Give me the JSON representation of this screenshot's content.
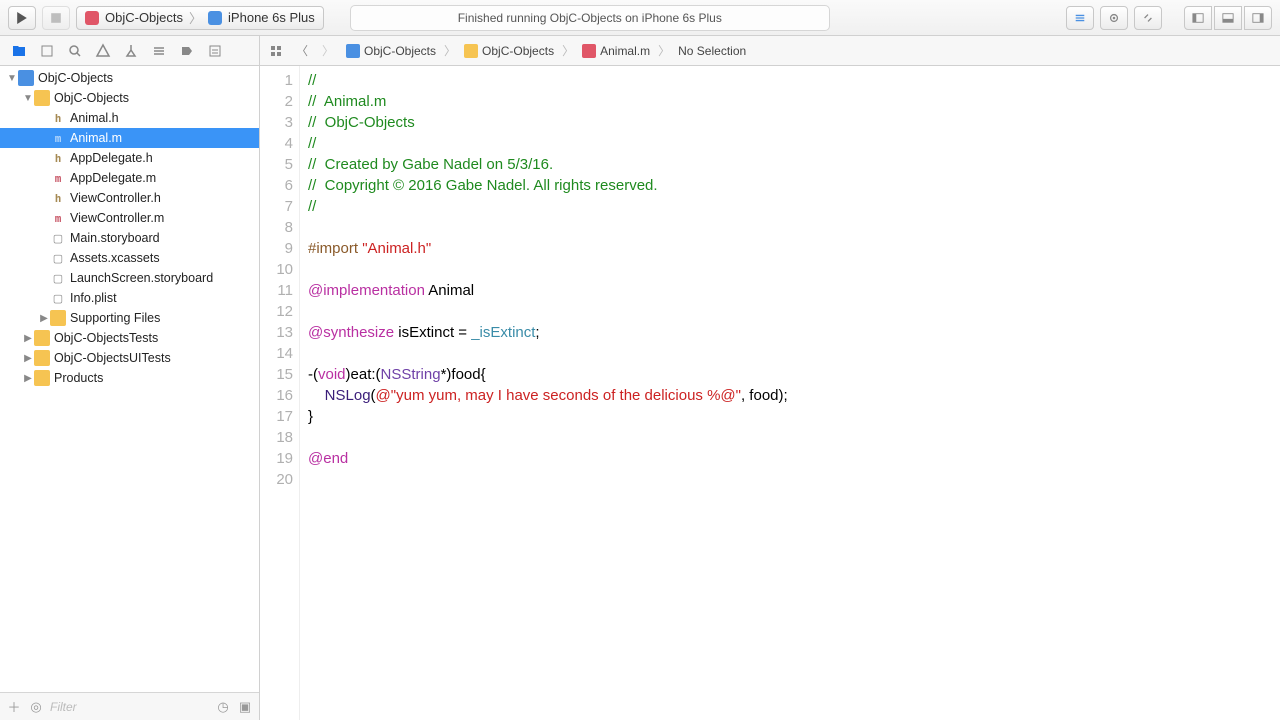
{
  "toolbar": {
    "scheme_target": "ObjC-Objects",
    "scheme_device": "iPhone 6s Plus",
    "status": "Finished running ObjC-Objects on iPhone 6s Plus"
  },
  "jumpbar": {
    "seg1": "ObjC-Objects",
    "seg2": "ObjC-Objects",
    "seg3": "Animal.m",
    "seg4": "No Selection"
  },
  "tree": [
    {
      "depth": 0,
      "kind": "proj",
      "label": "ObjC-Objects",
      "disclosure": "down"
    },
    {
      "depth": 1,
      "kind": "folder",
      "label": "ObjC-Objects",
      "disclosure": "down"
    },
    {
      "depth": 2,
      "kind": "h",
      "label": "Animal.h"
    },
    {
      "depth": 2,
      "kind": "m",
      "label": "Animal.m",
      "selected": true
    },
    {
      "depth": 2,
      "kind": "h",
      "label": "AppDelegate.h"
    },
    {
      "depth": 2,
      "kind": "m",
      "label": "AppDelegate.m"
    },
    {
      "depth": 2,
      "kind": "h",
      "label": "ViewController.h"
    },
    {
      "depth": 2,
      "kind": "m",
      "label": "ViewController.m"
    },
    {
      "depth": 2,
      "kind": "g",
      "label": "Main.storyboard"
    },
    {
      "depth": 2,
      "kind": "g",
      "label": "Assets.xcassets"
    },
    {
      "depth": 2,
      "kind": "g",
      "label": "LaunchScreen.storyboard"
    },
    {
      "depth": 2,
      "kind": "g",
      "label": "Info.plist"
    },
    {
      "depth": 2,
      "kind": "folder",
      "label": "Supporting Files",
      "disclosure": "right"
    },
    {
      "depth": 1,
      "kind": "folder",
      "label": "ObjC-ObjectsTests",
      "disclosure": "right"
    },
    {
      "depth": 1,
      "kind": "folder",
      "label": "ObjC-ObjectsUITests",
      "disclosure": "right"
    },
    {
      "depth": 1,
      "kind": "folder",
      "label": "Products",
      "disclosure": "right"
    }
  ],
  "filter_placeholder": "Filter",
  "code_lines": [
    [
      {
        "c": "c-comment",
        "t": "//"
      }
    ],
    [
      {
        "c": "c-comment",
        "t": "//  Animal.m"
      }
    ],
    [
      {
        "c": "c-comment",
        "t": "//  ObjC-Objects"
      }
    ],
    [
      {
        "c": "c-comment",
        "t": "//"
      }
    ],
    [
      {
        "c": "c-comment",
        "t": "//  Created by Gabe Nadel on 5/3/16."
      }
    ],
    [
      {
        "c": "c-comment",
        "t": "//  Copyright © 2016 Gabe Nadel. All rights reserved."
      }
    ],
    [
      {
        "c": "c-comment",
        "t": "//"
      }
    ],
    [
      {
        "c": "",
        "t": ""
      }
    ],
    [
      {
        "c": "c-pp",
        "t": "#import "
      },
      {
        "c": "c-str",
        "t": "\"Animal.h\""
      }
    ],
    [
      {
        "c": "",
        "t": ""
      }
    ],
    [
      {
        "c": "c-kw",
        "t": "@implementation"
      },
      {
        "c": "",
        "t": " Animal"
      }
    ],
    [
      {
        "c": "",
        "t": ""
      }
    ],
    [
      {
        "c": "c-kw",
        "t": "@synthesize"
      },
      {
        "c": "",
        "t": " isExtinct = "
      },
      {
        "c": "c-ivar",
        "t": "_isExtinct"
      },
      {
        "c": "",
        "t": ";"
      }
    ],
    [
      {
        "c": "",
        "t": ""
      }
    ],
    [
      {
        "c": "",
        "t": "-("
      },
      {
        "c": "c-kw",
        "t": "void"
      },
      {
        "c": "",
        "t": ")eat:("
      },
      {
        "c": "c-type",
        "t": "NSString"
      },
      {
        "c": "",
        "t": "*)food{"
      }
    ],
    [
      {
        "c": "",
        "t": "    "
      },
      {
        "c": "c-func",
        "t": "NSLog"
      },
      {
        "c": "",
        "t": "("
      },
      {
        "c": "c-str",
        "t": "@\"yum yum, may I have seconds of the delicious %@\""
      },
      {
        "c": "",
        "t": ", food);"
      }
    ],
    [
      {
        "c": "",
        "t": "}"
      }
    ],
    [
      {
        "c": "",
        "t": ""
      }
    ],
    [
      {
        "c": "c-kw",
        "t": "@end"
      }
    ],
    [
      {
        "c": "",
        "t": ""
      }
    ]
  ]
}
